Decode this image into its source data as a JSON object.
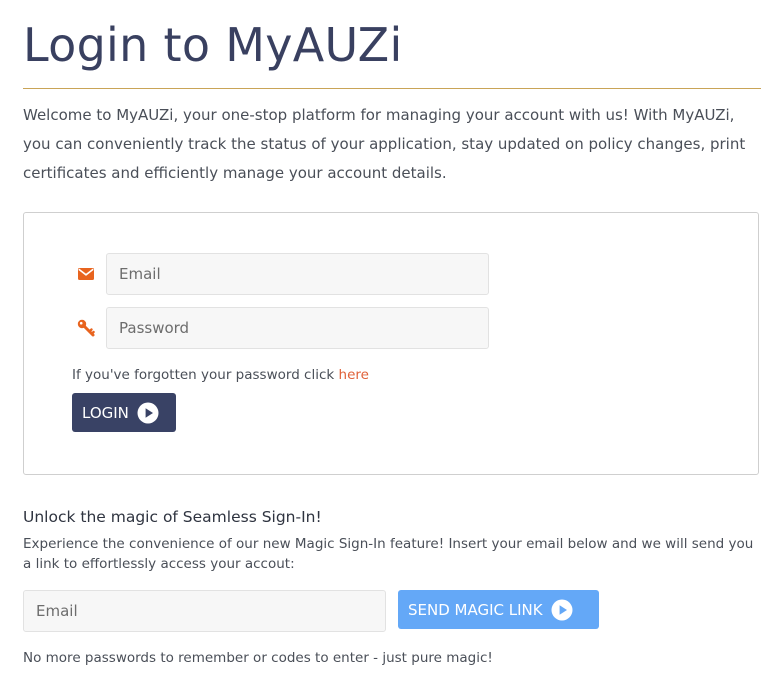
{
  "page": {
    "title": "Login to MyAUZi",
    "intro": "Welcome to MyAUZi, your one-stop platform for managing your account with us! With MyAUZi, you can conveniently track the status of your application, stay updated on policy changes, print certificates and efficiently manage your account details."
  },
  "login_form": {
    "email_placeholder": "Email",
    "email_icon": "envelope-icon",
    "password_placeholder": "Password",
    "password_icon": "key-icon",
    "forgot_text": "If you've forgotten your password click ",
    "forgot_link": "here",
    "login_label": "LOGIN",
    "login_icon": "play-circle-icon"
  },
  "magic": {
    "heading": "Unlock the magic of Seamless Sign-In!",
    "description": "Experience the convenience of our new Magic Sign-In feature! Insert your email below and we will send you a link to effortlessly access your accout:",
    "email_placeholder": "Email",
    "button_label": "SEND MAGIC LINK",
    "button_icon": "play-circle-icon",
    "footnote": "No more passwords to remember or codes to enter - just pure magic!"
  },
  "colors": {
    "title": "#394060",
    "rule": "#c9a457",
    "icon_accent": "#e8641f",
    "link": "#e0623a",
    "login_button": "#394265",
    "magic_button": "#64a8f7"
  }
}
